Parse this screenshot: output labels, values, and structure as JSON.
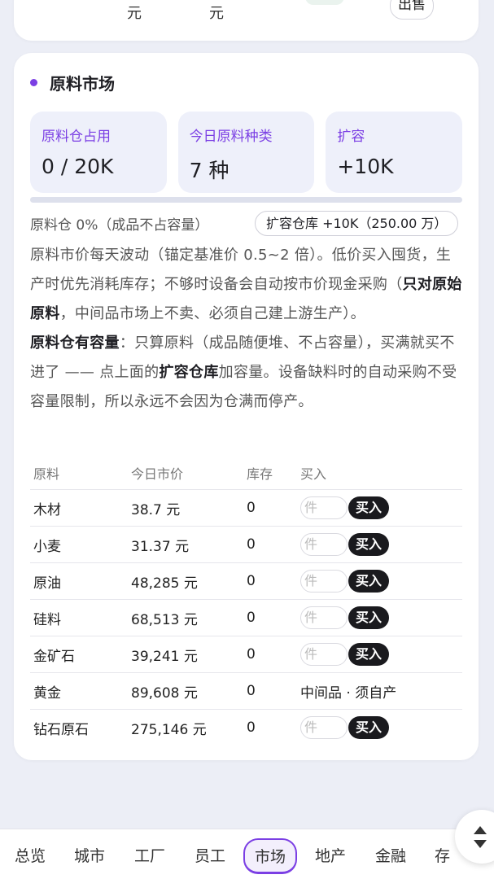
{
  "top_card": {
    "unit_1": "元",
    "unit_2": "元",
    "sell_label": "出售"
  },
  "market": {
    "title": "原料市场",
    "stats": [
      {
        "label": "原料仓占用",
        "value": "0 / 20K"
      },
      {
        "label": "今日原料种类",
        "value": "7 种"
      },
      {
        "label": "扩容",
        "value": "+10K"
      }
    ],
    "progress_percent": 0,
    "status_text": "原料仓 0%（成品不占容量）",
    "expand_button": "扩容仓库 +10K（250.00 万）",
    "desc_p1_a": "原料市价每天波动（锚定基准价 0.5~2 倍）。低价买入囤货，生产时优先消耗库存；不够时设备会自动按市价现金采购（",
    "desc_p1_b": "只对原始原料",
    "desc_p1_c": "，中间品市场上不卖、必须自己建上游生产）。",
    "desc_p2_a": "原料仓有容量",
    "desc_p2_b": "：只算原料（成品随便堆、不占容量），买满就买不进了 —— 点上面的",
    "desc_p2_c": "扩容仓库",
    "desc_p2_d": "加容量。设备缺料时的自动采购不受容量限制，所以永远不会因为仓满而停产。",
    "table": {
      "headers": [
        "原料",
        "今日市价",
        "库存",
        "买入"
      ],
      "qty_placeholder": "件",
      "buy_label": "买入",
      "intermediate_note": "中间品 · 须自产",
      "rows": [
        {
          "name": "木材",
          "price": "38.7 元",
          "stock": "0"
        },
        {
          "name": "小麦",
          "price": "31.37 元",
          "stock": "0"
        },
        {
          "name": "原油",
          "price": "48,285 元",
          "stock": "0"
        },
        {
          "name": "硅料",
          "price": "68,513 元",
          "stock": "0"
        },
        {
          "name": "金矿石",
          "price": "39,241 元",
          "stock": "0"
        },
        {
          "name": "黄金",
          "price": "89,608 元",
          "stock": "0"
        },
        {
          "name": "钻石原石",
          "price": "275,146 元",
          "stock": "0"
        }
      ]
    }
  },
  "nav": {
    "items": [
      "总览",
      "城市",
      "工厂",
      "员工",
      "市场",
      "地产",
      "金融",
      "存"
    ],
    "active": "市场"
  },
  "colors": {
    "accent": "#7b3fe4",
    "buy_button": "#1a1a1e"
  }
}
